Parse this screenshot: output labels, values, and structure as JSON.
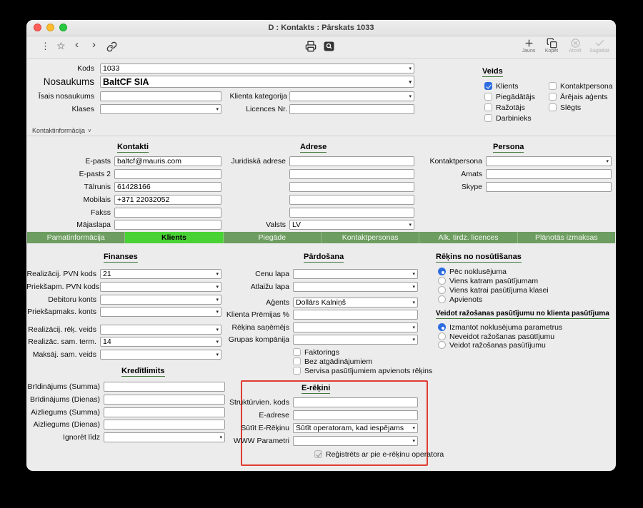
{
  "window": {
    "title": "D : Kontakts : Pārskats 1033"
  },
  "toolbar": {
    "new": "Jauns",
    "copy": "Kopēt",
    "cancel": "Atcelt",
    "save": "Saglabāt"
  },
  "top": {
    "kods": {
      "label": "Kods",
      "value": "1033"
    },
    "nosaukums": {
      "label": "Nosaukums",
      "value": "BaltCF SIA"
    },
    "isais": {
      "label": "Īsais nosaukums",
      "value": ""
    },
    "kategorija": {
      "label": "Klienta kategorija",
      "value": ""
    },
    "klases": {
      "label": "Klases",
      "value": ""
    },
    "licences": {
      "label": "Licences Nr.",
      "value": ""
    }
  },
  "veids": {
    "heading": "Veids",
    "items": [
      {
        "label": "Klients",
        "checked": true
      },
      {
        "label": "Kontaktpersona",
        "checked": false
      },
      {
        "label": "Piegādātājs",
        "checked": false
      },
      {
        "label": "Ārējais aģents",
        "checked": false
      },
      {
        "label": "Ražotājs",
        "checked": false
      },
      {
        "label": "Slēgts",
        "checked": false
      },
      {
        "label": "Darbinieks",
        "checked": false
      }
    ]
  },
  "section": {
    "kontaktinformacija": "Kontaktinformācija"
  },
  "kontakti": {
    "heading": "Kontakti",
    "epasts": {
      "label": "E-pasts",
      "value": "baltcf@mauris.com"
    },
    "epasts2": {
      "label": "E-pasts 2",
      "value": ""
    },
    "talrunis": {
      "label": "Tālrunis",
      "value": "61428166"
    },
    "mobilais": {
      "label": "Mobilais",
      "value": "+371 22032052"
    },
    "fakss": {
      "label": "Fakss",
      "value": ""
    },
    "majaslapa": {
      "label": "Mājaslapa",
      "value": ""
    }
  },
  "adrese": {
    "heading": "Adrese",
    "juridiska_label": "Juridiskā adrese",
    "lines": [
      "",
      "",
      "",
      "",
      ""
    ],
    "valsts": {
      "label": "Valsts",
      "value": "LV"
    }
  },
  "persona": {
    "heading": "Persona",
    "kontaktpersona": {
      "label": "Kontaktpersona",
      "value": ""
    },
    "amats": {
      "label": "Amats",
      "value": ""
    },
    "skype": {
      "label": "Skype",
      "value": ""
    }
  },
  "tabs": [
    {
      "label": "Pamatinformācija",
      "active": false
    },
    {
      "label": "Klients",
      "active": true
    },
    {
      "label": "Piegāde",
      "active": false
    },
    {
      "label": "Kontaktpersonas",
      "active": false
    },
    {
      "label": "Alk. tirdz. licences",
      "active": false
    },
    {
      "label": "Plānotās izmaksas",
      "active": false
    }
  ],
  "finanses": {
    "heading": "Finanses",
    "rows": [
      {
        "label": "Realizācij. PVN kods",
        "value": "21"
      },
      {
        "label": "Priekšapm. PVN kods",
        "value": ""
      },
      {
        "label": "Debitoru konts",
        "value": ""
      },
      {
        "label": "Priekšapmaks. konts",
        "value": ""
      },
      {
        "label": "Realizācij. rēķ. veids",
        "value": ""
      },
      {
        "label": "Realizāc. sam. term.",
        "value": "14"
      },
      {
        "label": "Maksāj. sam. veids",
        "value": ""
      }
    ]
  },
  "kreditlimits": {
    "heading": "Kredītlimits",
    "rows": [
      {
        "label": "Brīdinājums (Summa)",
        "value": ""
      },
      {
        "label": "Brīdinājums (Dienas)",
        "value": ""
      },
      {
        "label": "Aizliegums (Summa)",
        "value": ""
      },
      {
        "label": "Aizliegums (Dienas)",
        "value": ""
      },
      {
        "label": "Ignorēt līdz",
        "value": ""
      }
    ]
  },
  "pardosana": {
    "heading": "Pārdošana",
    "cenu_lapa": {
      "label": "Cenu lapa",
      "value": ""
    },
    "atlaizu_lapa": {
      "label": "Atlaižu lapa",
      "value": ""
    },
    "agents": {
      "label": "Aģents",
      "value": "Dollārs Kalniņš"
    },
    "premijas": {
      "label": "Klienta Prēmijas %",
      "value": ""
    },
    "sanemejs": {
      "label": "Rēķina saņēmējs",
      "value": ""
    },
    "grupas": {
      "label": "Grupas kompānija",
      "value": ""
    },
    "checks": [
      {
        "label": "Faktorings",
        "checked": false
      },
      {
        "label": "Bez atgādinājumiem",
        "checked": false
      },
      {
        "label": "Servisa pasūtījumiem apvienots rēķins",
        "checked": false
      }
    ]
  },
  "erekini": {
    "heading": "E-rēķini",
    "strukturvien": {
      "label": "Struktūrvien. kods",
      "value": ""
    },
    "eadrese": {
      "label": "E-adrese",
      "value": ""
    },
    "sutit": {
      "label": "Sūtīt E-Rēķinu",
      "value": "Sūtīt operatoram, kad iespējams"
    },
    "www": {
      "label": "WWW Parametri",
      "value": ""
    },
    "registrets": {
      "label": "Reģistrēts ar pie e-rēķinu operatora",
      "checked": true
    }
  },
  "rekins_no": {
    "heading": "Rēķins no nosūtīšanas",
    "options": [
      {
        "label": "Pēc noklusējuma",
        "selected": true
      },
      {
        "label": "Viens katram pasūtījumam",
        "selected": false
      },
      {
        "label": "Viens katrai pasūtījuma klasei",
        "selected": false
      },
      {
        "label": "Apvienots",
        "selected": false
      }
    ]
  },
  "razosanas": {
    "heading": "Veidot ražošanas pasūtījumu no klienta pasūtījuma",
    "options": [
      {
        "label": "Izmantot noklusējuma parametrus",
        "selected": true
      },
      {
        "label": "Neveidot ražošanas pasūtījumu",
        "selected": false
      },
      {
        "label": "Veidot ražošanas pasūtījumu",
        "selected": false
      }
    ]
  }
}
